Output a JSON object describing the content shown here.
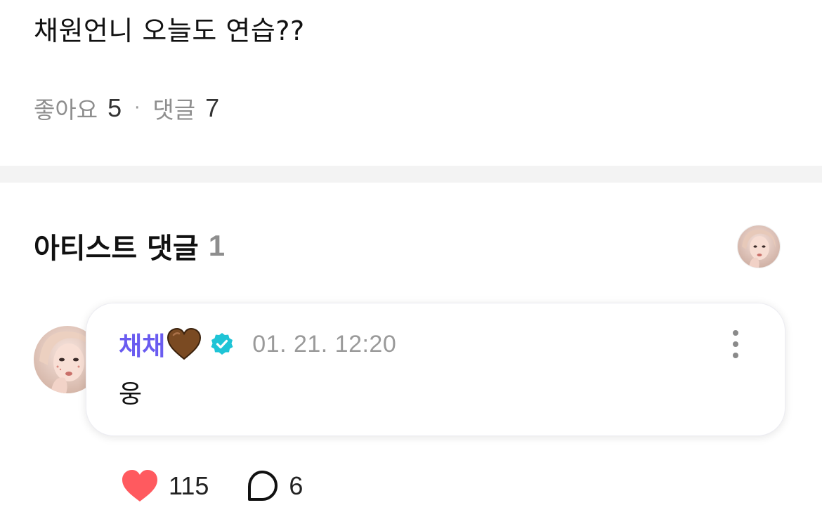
{
  "post": {
    "text": "채원언니 오늘도 연습??",
    "likes_label": "좋아요",
    "likes_count": "5",
    "separator": "·",
    "comments_label": "댓글",
    "comments_count": "7"
  },
  "artist_comments": {
    "title": "아티스트 댓글",
    "count": "1"
  },
  "comment": {
    "author": "채채",
    "author_color": "#6a5cf0",
    "emoji_icon": "brown-heart-icon",
    "verified_icon": "verified-badge-icon",
    "timestamp": "01. 21. 12:20",
    "body": "웅",
    "like_count": "115",
    "reply_count": "6"
  },
  "colors": {
    "accent_like": "#ff5a5f",
    "verified": "#1fc4d6",
    "divider": "#f3f3f3"
  }
}
